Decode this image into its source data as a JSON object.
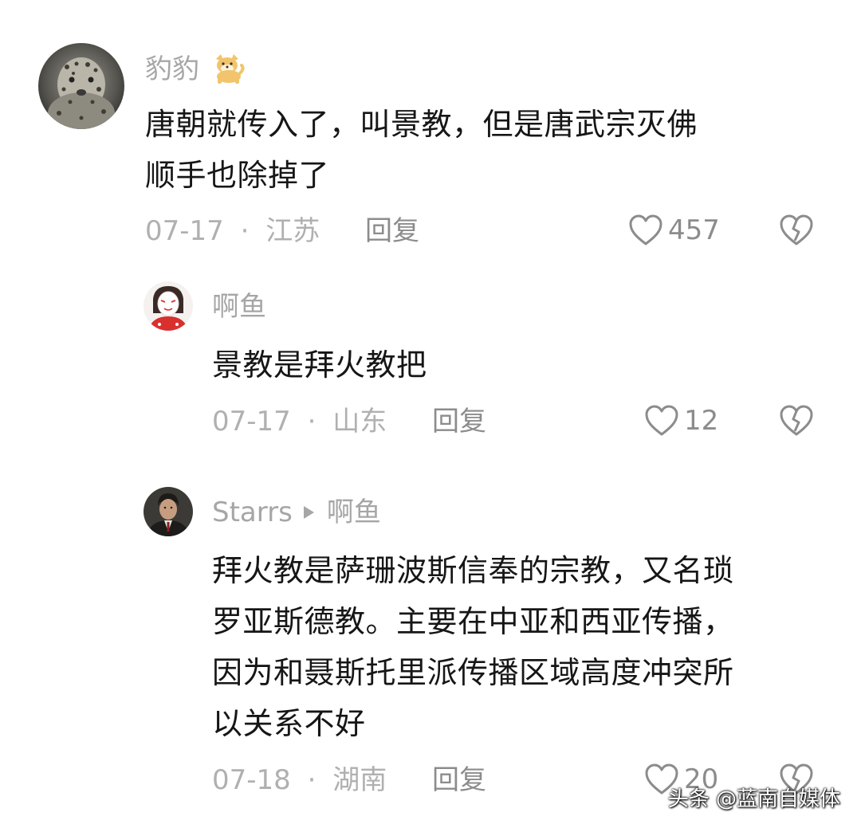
{
  "comments": [
    {
      "username": "豹豹",
      "body_lines": [
        "唐朝就传入了，叫景教，但是唐武宗灭佛",
        "顺手也除掉了"
      ],
      "date": "07-17",
      "location": "江苏",
      "reply_label": "回复",
      "likes": "457"
    },
    {
      "username": "啊鱼",
      "body_lines": [
        "景教是拜火教把"
      ],
      "date": "07-17",
      "location": "山东",
      "reply_label": "回复",
      "likes": "12"
    },
    {
      "username": "Starrs",
      "reply_to": "啊鱼",
      "body_lines": [
        "拜火教是萨珊波斯信奉的宗教，又名琐",
        "罗亚斯德教。主要在中亚和西亚传播，",
        "因为和聂斯托里派传播区域高度冲突所",
        "以关系不好"
      ],
      "date": "07-18",
      "location": "湖南",
      "reply_label": "回复",
      "likes": "20"
    }
  ],
  "separator": "·",
  "watermark": "头条 @蓝南自媒体",
  "icons": {
    "like": "heart-outline-icon",
    "dislike": "broken-heart-icon",
    "badge": "shiba-dog-emoji-icon"
  },
  "colors": {
    "text": "#161616",
    "meta": "#b0b0b0",
    "name": "#a6a6a6"
  }
}
